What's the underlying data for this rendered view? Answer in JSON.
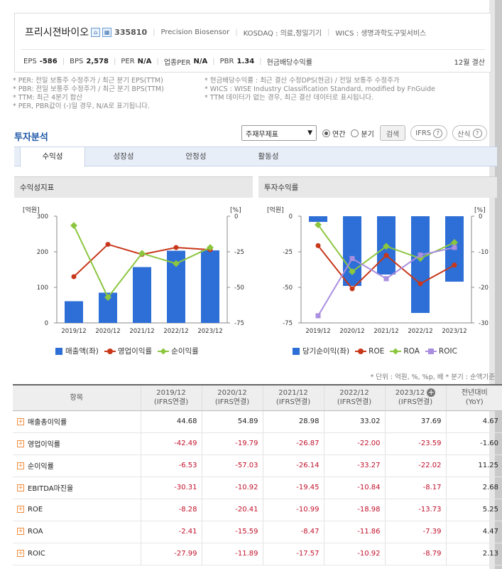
{
  "header": {
    "company_name": "프리시젼바이오",
    "icon1": "home-icon",
    "icon2": "building-icon",
    "code": "335810",
    "english_name": "Precision Biosensor",
    "market": "KOSDAQ : 의료,정밀기기",
    "wics": "WICS : 생명과학도구및서비스",
    "metrics": [
      {
        "label": "EPS",
        "value": "-586"
      },
      {
        "label": "BPS",
        "value": "2,578"
      },
      {
        "label": "PER",
        "value": "N/A"
      },
      {
        "label": "업종PER",
        "value": "N/A"
      },
      {
        "label": "PBR",
        "value": "1.34"
      },
      {
        "label": "현금배당수익률",
        "value": ""
      }
    ],
    "settlement": "12월 결산"
  },
  "notes": {
    "left": [
      "* PER: 전일 보통주 수정주가 / 최근 분기 EPS(TTM)",
      "* PBR: 전일 보통주 수정주가 / 최근 분기 BPS(TTM)",
      "* TTM: 최근 4분기 합산",
      "* PER, PBR값이 (-)일 경우, N/A로 표기됩니다."
    ],
    "right": [
      "* 현금배당수익률 : 최근 결산 수정DPS(현금) / 전일 보통주 수정주가",
      "* WICS : WISE Industry Classification Standard, modified by FnGuide",
      "* TTM 데이터가 없는 경우, 최근 결산 데이터로 표시됩니다."
    ]
  },
  "section": {
    "title": "투자분석",
    "select_value": "주재무제표",
    "radio_annual": "연간",
    "radio_quarter": "분기",
    "search_button": "검색",
    "ifrs_button": "IFRS",
    "formula_button": "산식"
  },
  "tabs": [
    "수익성",
    "성장성",
    "안정성",
    "활동성"
  ],
  "panels": {
    "left_title": "수익성지표",
    "right_title": "투자수익률"
  },
  "chart_data": [
    {
      "type": "bar",
      "title": "수익성지표",
      "categories": [
        "2019/12",
        "2020/12",
        "2021/12",
        "2022/12",
        "2023/12"
      ],
      "left_axis_label": "[억원]",
      "right_axis_label": "[%]",
      "left_ylim": [
        0,
        300
      ],
      "left_ticks": [
        "300",
        "200",
        "100",
        "0"
      ],
      "right_ylim": [
        -75,
        0
      ],
      "right_ticks": [
        "0",
        "-25",
        "-50",
        "-75"
      ],
      "series": [
        {
          "name": "매출액(좌)",
          "kind": "bar",
          "axis": "left",
          "color": "#2d6fd6",
          "values": [
            61,
            85,
            157,
            203,
            204
          ]
        },
        {
          "name": "영업이익률",
          "kind": "line",
          "axis": "right",
          "color": "#c8371a",
          "values": [
            -42.49,
            -19.79,
            -26.87,
            -22.0,
            -23.59
          ]
        },
        {
          "name": "순이익률",
          "kind": "line",
          "axis": "right",
          "color": "#8cc63f",
          "values": [
            -6.53,
            -57.03,
            -26.14,
            -33.27,
            -22.02
          ]
        }
      ],
      "legend": "bottom"
    },
    {
      "type": "bar",
      "title": "투자수익률",
      "categories": [
        "2019/12",
        "2020/12",
        "2021/12",
        "2022/12",
        "2023/12"
      ],
      "left_axis_label": "[억원]",
      "right_axis_label": "[%]",
      "left_ylim": [
        -75,
        0
      ],
      "left_ticks": [
        "0",
        "-25",
        "-50",
        "-75"
      ],
      "right_ylim": [
        -30,
        0
      ],
      "right_ticks": [
        "0",
        "-10",
        "-20",
        "-30"
      ],
      "series": [
        {
          "name": "당기순이익(좌)",
          "kind": "bar",
          "axis": "left",
          "color": "#2d6fd6",
          "values": [
            -4,
            -49,
            -41,
            -68,
            -46
          ]
        },
        {
          "name": "ROE",
          "kind": "line",
          "axis": "right",
          "color": "#c8371a",
          "values": [
            -8.28,
            -20.41,
            -10.99,
            -18.98,
            -13.73
          ]
        },
        {
          "name": "ROA",
          "kind": "line",
          "axis": "right",
          "color": "#8cc63f",
          "values": [
            -2.41,
            -15.59,
            -8.47,
            -11.86,
            -7.39
          ]
        },
        {
          "name": "ROIC",
          "kind": "line",
          "axis": "right",
          "color": "#a98ee0",
          "values": [
            -27.99,
            -11.89,
            -17.57,
            -10.92,
            -8.79
          ]
        }
      ],
      "legend": "bottom"
    }
  ],
  "unit_note": "* 단위 : 억원, %, %p, 배     * 분기 : 순액기준",
  "table": {
    "headers": [
      {
        "l1": "항목",
        "l2": ""
      },
      {
        "l1": "2019/12",
        "l2": "(IFRS연결)"
      },
      {
        "l1": "2020/12",
        "l2": "(IFRS연결)"
      },
      {
        "l1": "2021/12",
        "l2": "(IFRS연결)"
      },
      {
        "l1": "2022/12",
        "l2": "(IFRS연결)"
      },
      {
        "l1": "2023/12",
        "l2": "(IFRS연결)"
      },
      {
        "l1": "전년대비",
        "l2": "(YoY)"
      }
    ],
    "rows": [
      {
        "label": "매출총이익률",
        "values": [
          "44.68",
          "54.89",
          "28.98",
          "33.02",
          "37.69",
          "4.67"
        ]
      },
      {
        "label": "영업이익률",
        "values": [
          "-42.49",
          "-19.79",
          "-26.87",
          "-22.00",
          "-23.59",
          "-1.60"
        ]
      },
      {
        "label": "순이익률",
        "values": [
          "-6.53",
          "-57.03",
          "-26.14",
          "-33.27",
          "-22.02",
          "11.25"
        ]
      },
      {
        "label": "EBITDA마진율",
        "values": [
          "-30.31",
          "-10.92",
          "-19.45",
          "-10.84",
          "-8.17",
          "2.68"
        ]
      },
      {
        "label": "ROE",
        "values": [
          "-8.28",
          "-20.41",
          "-10.99",
          "-18.98",
          "-13.73",
          "5.25"
        ]
      },
      {
        "label": "ROA",
        "values": [
          "-2.41",
          "-15.59",
          "-8.47",
          "-11.86",
          "-7.39",
          "4.47"
        ]
      },
      {
        "label": "ROIC",
        "values": [
          "-27.99",
          "-11.89",
          "-17.57",
          "-10.92",
          "-8.79",
          "2.13"
        ]
      }
    ]
  }
}
